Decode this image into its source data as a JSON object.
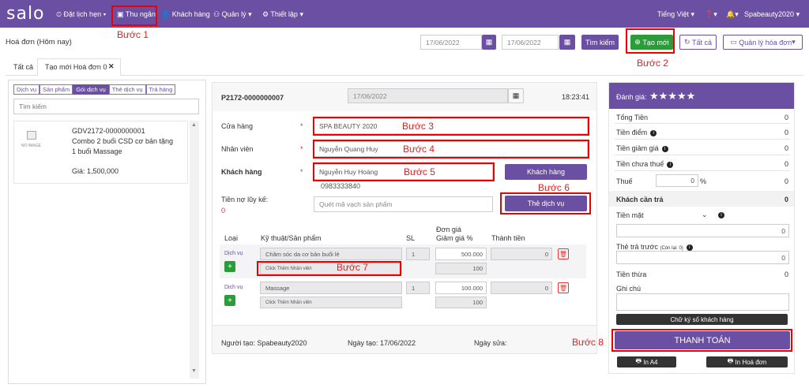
{
  "nav": {
    "logo": "salo",
    "items": [
      "Đặt lịch hẹn",
      "Thu ngân",
      "Khách hàng",
      "Quản lý",
      "Thiết lập"
    ],
    "lang": "Tiếng Việt",
    "user": "Spabeauty2020"
  },
  "header": {
    "title": "Hoá đơn (Hôm nay)",
    "date_from": "17/06/2022",
    "date_to": "17/06/2022",
    "search": "Tìm kiếm",
    "new": "Tạo mới",
    "all": "Tất cả",
    "manage": "Quản lý hóa đơn"
  },
  "tabs": [
    "Tất cả",
    "Tạo mới Hoá đơn 0"
  ],
  "steps": {
    "s1": "Bước 1",
    "s2": "Bước 2",
    "s3": "Bước 3",
    "s4": "Bước 4",
    "s5": "Bước 5",
    "s6": "Bước 6",
    "s7": "Bước 7",
    "s8": "Bước 8"
  },
  "left": {
    "subtabs": [
      "Dịch vụ",
      "Sản phẩm",
      "Gói dịch vụ",
      "Thẻ dịch vụ",
      "Trả hàng"
    ],
    "search_placeholder": "Tìm kiếm",
    "noimage": "NO IMAGE",
    "product": {
      "code": "GDV2172-0000000001",
      "name": "Combo 2 buổi CSD cơ bản tặng",
      "extra": "1 buổi Massage",
      "price": "Giá: 1,500,000"
    }
  },
  "invoice": {
    "code": "P2172-0000000007",
    "date": "17/06/2022",
    "time": "18:23:41",
    "store_label": "Cửa hàng",
    "store": "SPA BEAUTY 2020",
    "staff_label": "Nhân viên",
    "staff": "Nguyễn Quang Huy",
    "customer_label": "Khách hàng",
    "customer": "Nguyễn Huy Hoàng",
    "phone": "0983333840",
    "customer_btn": "Khách hàng",
    "debt_label": "Tiền nợ lũy kế:",
    "debt": "0",
    "barcode_placeholder": "Quét mã vạch sản phẩm",
    "card_btn": "Thẻ dịch vụ",
    "cols": {
      "type": "Loại",
      "tech": "Kỹ thuật/Sản phẩm",
      "qty": "SL",
      "price": "Đơn giá",
      "discount": "Giảm giá %",
      "total": "Thành tiền"
    },
    "rows": [
      {
        "type": "Dịch vụ",
        "name": "Chăm sóc da cơ bản buổi lẻ",
        "staff": "Click Thêm Nhân viên",
        "qty": "1",
        "price": "500.000",
        "disc": "100",
        "total": "0"
      },
      {
        "type": "Dịch vụ",
        "name": "Massage",
        "staff": "Click Thêm Nhân viên",
        "qty": "1",
        "price": "100.000",
        "disc": "100",
        "total": "0"
      }
    ],
    "creator": "Người tạo: Spabeauty2020",
    "created": "Ngày tạo: 17/06/2022",
    "modified": "Ngày sửa:"
  },
  "right": {
    "rating": "Đánh giá:",
    "stars": "★★★★★",
    "total": "Tổng Tiền",
    "points": "Tiền điểm",
    "discount": "Tiền giảm giá",
    "pretax": "Tiền chưa thuế",
    "tax": "Thuế",
    "tax_val": "0",
    "pct": "%",
    "due": "Khách cần trả",
    "cash": "Tiền mặt",
    "prepaid": "Thẻ trả trước",
    "prepaid_note": "(Còn lại: 0)",
    "change": "Tiền thừa",
    "note": "Ghi chú",
    "sign": "Chữ ký số khách hàng",
    "pay": "THANH TOÁN",
    "a4": "In A4",
    "print": "In Hoá đơn",
    "zero": "0"
  },
  "colors": {
    "brand": "#6a4fa3",
    "green": "#2a9d3a",
    "red": "#e00000"
  }
}
